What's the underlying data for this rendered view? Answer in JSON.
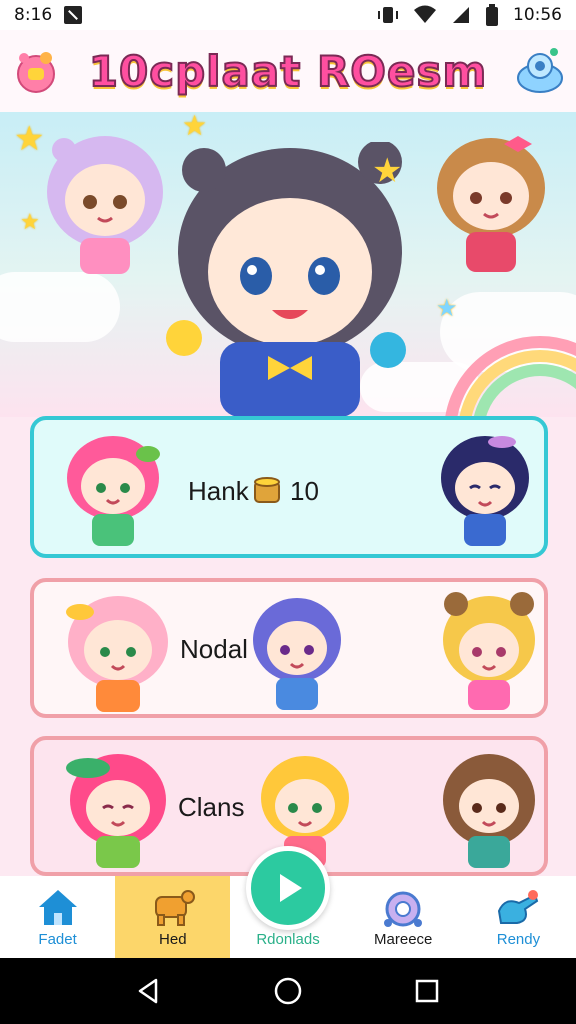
{
  "status_bar": {
    "time_left": "8:16",
    "time_right": "10:56"
  },
  "header": {
    "title": "10cplaat ROesm",
    "left_icon": "gift-pig-icon",
    "right_icon": "robot-helper-icon"
  },
  "panels": [
    {
      "label": "Hank",
      "count": "10",
      "icon": "coin-cup-icon"
    },
    {
      "label": "Nodal"
    },
    {
      "label": "Clans"
    }
  ],
  "bottom_nav": {
    "items": [
      {
        "label": "Fadet",
        "icon": "home-icon",
        "color": "#1e8fd6"
      },
      {
        "label": "Hed",
        "icon": "pet-icon",
        "color": "#1a1a1a"
      },
      {
        "label": "Rdonlads",
        "icon": "play-icon",
        "color": "#2ab089"
      },
      {
        "label": "Mareece",
        "icon": "ring-icon",
        "color": "#1a1a1a"
      },
      {
        "label": "Rendy",
        "icon": "shoe-icon",
        "color": "#1e8fd6"
      }
    ]
  },
  "colors": {
    "accent": "#ff4fa0",
    "panel_teal": "#35c8d4",
    "panel_pink": "#f0a0a8",
    "nav_active": "#fcd66a",
    "fab": "#2ccaa0"
  }
}
